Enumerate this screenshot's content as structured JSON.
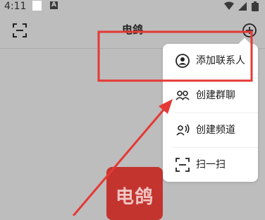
{
  "status_bar": {
    "time": "4:11",
    "badge_letter": "A",
    "icons": [
      "notification-square",
      "app-badge-a",
      "wifi-icon",
      "signal-icon",
      "battery-icon"
    ]
  },
  "header": {
    "title": "电鸽",
    "left_icon": "scan-icon",
    "right_icon": "plus-circle-icon"
  },
  "logo": {
    "text": "电鸽",
    "color": "#c4342f"
  },
  "menu": {
    "items": [
      {
        "label": "添加联系人",
        "icon": "person-circle-icon"
      },
      {
        "label": "创建群聊",
        "icon": "group-icon"
      },
      {
        "label": "创建频道",
        "icon": "channel-icon"
      },
      {
        "label": "扫一扫",
        "icon": "scan-icon"
      }
    ]
  },
  "annotation": {
    "color": "#e53935"
  }
}
